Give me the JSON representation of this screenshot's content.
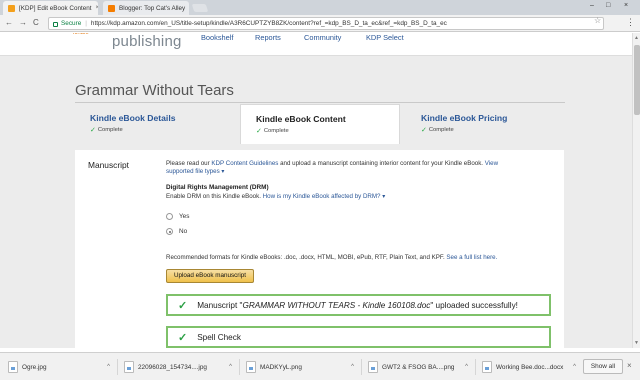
{
  "browser": {
    "tabs": [
      {
        "label": "[KDP] Edit eBook Content",
        "favicon_color": "#f4a01c",
        "active": true
      },
      {
        "label": "Blogger: Top Cat's Alley",
        "favicon_color": "#f57d00",
        "active": false
      }
    ],
    "close_glyph": "×",
    "window_controls": {
      "minimize": "–",
      "maximize": "□",
      "close": "×"
    },
    "nav": {
      "back": "←",
      "forward": "→",
      "reload": "C"
    },
    "secure_label": "Secure",
    "separator": "|",
    "url": "https://kdp.amazon.com/en_US/title-setup/kindle/A3R6CUPTZYB8ZK/content?ref_=kdp_BS_D_ta_ec&ref_=kdp_BS_D_ta_ec",
    "star_glyph": "☆",
    "menu_glyph": "⋮"
  },
  "kdp_header": {
    "brand_small": "kindle",
    "brand": "publishing",
    "nav_items": [
      "Bookshelf",
      "Reports",
      "Community",
      "KDP Select"
    ]
  },
  "page": {
    "title": "Grammar Without Tears",
    "steps": [
      {
        "label": "Kindle eBook Details",
        "status": "Complete",
        "active": false
      },
      {
        "label": "Kindle eBook Content",
        "status": "Complete",
        "active": true
      },
      {
        "label": "Kindle eBook Pricing",
        "status": "Complete",
        "active": false
      }
    ],
    "check_glyph": "✓"
  },
  "manuscript": {
    "section_title": "Manuscript",
    "intro_pre": "Please read our ",
    "intro_link": "KDP Content Guidelines",
    "intro_post": " and upload a manuscript containing interior content for your Kindle eBook. ",
    "file_types_link": "View supported file types ▾",
    "drm_title": "Digital Rights Management (DRM)",
    "drm_text": "Enable DRM on this Kindle eBook. ",
    "drm_link": "How is my Kindle eBook affected by DRM? ▾",
    "options": [
      "Yes",
      "No"
    ],
    "selected_option": "No",
    "formats_text": "Recommended formats for Kindle eBooks: .doc, .docx, HTML, MOBI, ePub, RTF, Plain Text, and KPF. ",
    "formats_link": "See a full list here.",
    "upload_button": "Upload eBook manuscript",
    "success_pre": "Manuscript \"",
    "success_file": "GRAMMAR WITHOUT TEARS - Kindle 160108.doc",
    "success_post": "\" uploaded successfully!",
    "spell_check": "Spell Check",
    "big_check_glyph": "✓"
  },
  "downloads": {
    "items": [
      "Ogre.jpg",
      "22096028_154734....jpg",
      "MADKYyL.png",
      "GWT2 & FSOG BA....png",
      "Working Bee.doc...docx"
    ],
    "caret_glyph": "^",
    "show_all": "Show all",
    "close_glyph": "×"
  }
}
